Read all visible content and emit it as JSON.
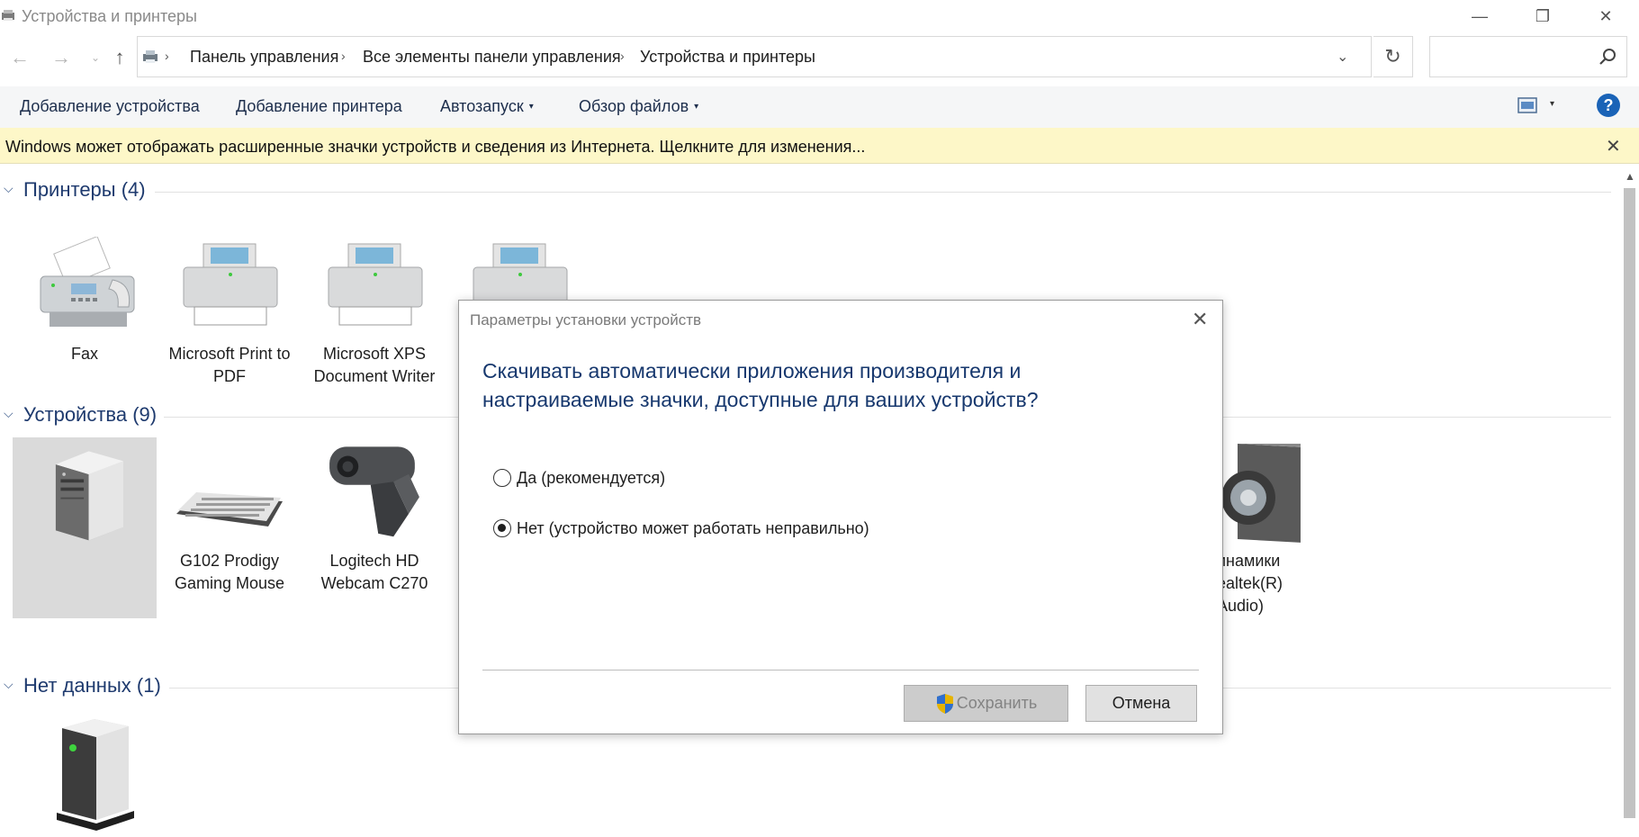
{
  "window": {
    "title": "Устройства и принтеры",
    "minimize_glyph": "—",
    "restore_glyph": "❐",
    "close_glyph": "✕"
  },
  "navigation": {
    "back_glyph": "←",
    "forward_glyph": "→",
    "recent_glyph": "⌄",
    "up_glyph": "↑",
    "breadcrumbs": [
      "Панель управления",
      "Все элементы панели управления",
      "Устройства и принтеры"
    ],
    "separator_glyph": "›",
    "dropdown_glyph": "⌄",
    "refresh_glyph": "↻",
    "search_placeholder": ""
  },
  "toolbar": {
    "add_device": "Добавление устройства",
    "add_printer": "Добавление принтера",
    "autoplay": "Автозапуск",
    "browse_files": "Обзор файлов",
    "caret_glyph": "▾",
    "help": "?"
  },
  "infobar": {
    "text": "Windows может отображать расширенные значки устройств и сведения из Интернета.  Щелкните для изменения...",
    "close_glyph": "✕"
  },
  "groups": {
    "chevron_glyph": "⌵",
    "printers": {
      "title": "Принтеры (4)",
      "items": [
        {
          "label": "Fax"
        },
        {
          "label": "Microsoft Print to PDF"
        },
        {
          "label": "Microsoft XPS Document Writer"
        },
        {
          "label": ""
        }
      ]
    },
    "devices": {
      "title": "Устройства (9)",
      "items": [
        {
          "label": ""
        },
        {
          "label": "G102 Prodigy Gaming Mouse"
        },
        {
          "label": "Logitech HD Webcam C270"
        },
        {
          "label": "инамики\nealtek(R)\nAudio)"
        }
      ]
    },
    "unspecified": {
      "title": "Нет данных (1)"
    }
  },
  "scrollbar": {
    "up_glyph": "▲"
  },
  "dialog": {
    "title": "Параметры установки устройств",
    "close_glyph": "✕",
    "question": "Скачивать автоматически приложения производителя и настраиваемые значки, доступные для ваших устройств?",
    "option_yes": "Да (рекомендуется)",
    "option_no": "Нет (устройство может работать неправильно)",
    "save": "Сохранить",
    "cancel": "Отмена"
  },
  "colors": {
    "accent": "#1a63b7",
    "group_title": "#1e3a6e",
    "infobar_bg": "#fdf7c8",
    "selected_bg": "#dadada"
  }
}
